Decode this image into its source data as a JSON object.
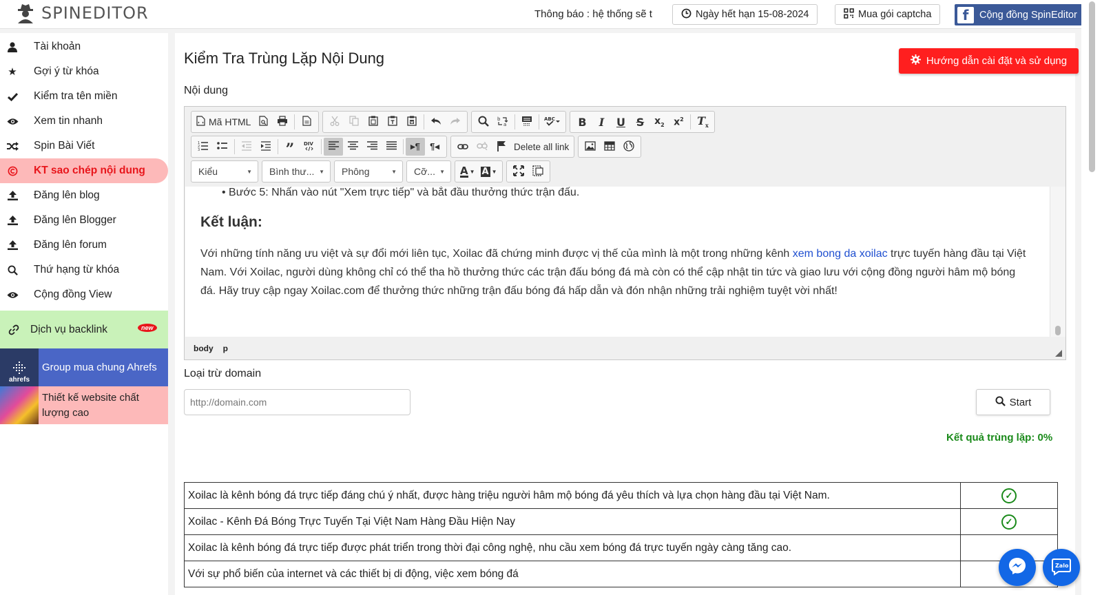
{
  "topbar": {
    "logo_text": "SPINEDITOR",
    "notice": "Thông báo : hệ thống sẽ t",
    "expiry": "Ngày hết hạn 15-08-2024",
    "captcha": "Mua gói captcha",
    "community": "Cộng đồng SpinEditor"
  },
  "sidebar": {
    "items": [
      {
        "label": "Tài khoản",
        "icon": "user-icon"
      },
      {
        "label": "Gợi ý từ khóa",
        "icon": "star-icon"
      },
      {
        "label": "Kiểm tra tên miền",
        "icon": "check-icon"
      },
      {
        "label": "Xem tin nhanh",
        "icon": "eye-icon"
      },
      {
        "label": "Spin Bài Viết",
        "icon": "shuffle-icon"
      },
      {
        "label": "KT sao chép nội dung",
        "icon": "copyright-icon"
      },
      {
        "label": "Đăng lên blog",
        "icon": "upload-icon"
      },
      {
        "label": "Đăng lên Blogger",
        "icon": "upload-icon"
      },
      {
        "label": "Đăng lên forum",
        "icon": "upload-icon"
      },
      {
        "label": "Thứ hạng từ khóa",
        "icon": "search-icon"
      },
      {
        "label": "Cộng đồng View",
        "icon": "eye-icon"
      }
    ],
    "backlink": "Dịch vụ backlink",
    "new_badge": "new",
    "ahrefs": "Group mua chung Ahrefs",
    "ahrefs_logo": "ahrefs",
    "website": "Thiết kế website chất lượng cao"
  },
  "main": {
    "title": "Kiểm Tra Trùng Lặp Nội Dung",
    "guide_button": "Hướng dẫn cài đặt và sử dụng",
    "content_label": "Nội dung",
    "domain_label": "Loại trừ domain",
    "domain_placeholder": "http://domain.com",
    "start_button": "Start",
    "result": "Kết quả trùng lặp: 0%"
  },
  "editor": {
    "html_button": "Mã HTML",
    "delete_links": "Delete all link",
    "combo_style": "Kiểu",
    "combo_format": "Bình thư...",
    "combo_font": "Phông",
    "combo_size": "Cỡ...",
    "bullet": "Bước 5: Nhấn vào nút \"Xem trực tiếp\" và bắt đầu thưởng thức trận đấu.",
    "heading": "Kết luận:",
    "para_before": "Với những tính năng ưu việt và sự đổi mới liên tục, Xoilac đã chứng minh được vị thế của mình là một trong những kênh ",
    "para_link": "xem bong da xoilac",
    "para_after": " trực tuyến hàng đầu tại Việt Nam. Với Xoilac, người dùng không chỉ có thể tha hồ thưởng thức các trận đấu bóng đá mà còn có thể cập nhật tin tức và giao lưu với cộng đồng người hâm mộ bóng đá. Hãy truy cập ngay Xoilac.com để thưởng thức những trận đấu bóng đá hấp dẫn và đón nhận những trải nghiệm tuyệt vời nhất!",
    "path_body": "body",
    "path_p": "p"
  },
  "results": [
    "Xoilac là kênh bóng đá trực tiếp đáng chú ý nhất, được hàng triệu người hâm mộ bóng đá yêu thích và lựa chọn hàng đầu tại Việt Nam.",
    "Xoilac - Kênh Đá Bóng Trực Tuyến Tại Việt Nam Hàng Đầu Hiện Nay",
    "Xoilac là kênh bóng đá trực tiếp được phát triển trong thời đại công nghệ, nhu cầu xem bóng đá trực tuyến ngày càng tăng cao.",
    "Với sự phổ biến của internet và các thiết bị di động, việc xem bóng đá"
  ],
  "colors": {
    "accent_red": "#ff1f1f",
    "active_bg": "#fdb9b9",
    "backlink_bg": "#c9f2b9",
    "ahrefs_bg": "#4a66c6",
    "result_green": "#1a8a1a",
    "facebook_blue": "#3b5998",
    "link_blue": "#1f4fd0"
  }
}
